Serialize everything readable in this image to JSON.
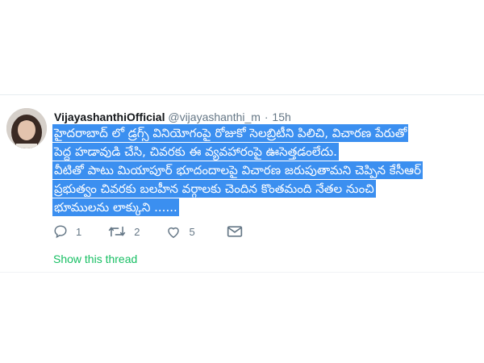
{
  "tweet": {
    "author_name": "VijayashanthiOfficial",
    "handle": "@vijayashanthi_m",
    "separator": "·",
    "time": "15h",
    "text_lines": [
      "హైదరాబాద్ లో డ్రగ్స్ వినియోగంపై రోజుకో సెలబ్రిటీని పిలిచి, విచారణ పేరుతో",
      "పెద్ద హడావుడి చేసి, చివరకు ఈ వ్యవహారంపై ఊసెత్తడంలేదు.",
      "వీటితో పాటు మియాపూర్ భూదందాలపై విచారణ జరుపుతామని చెప్పిన కేసీఆర్",
      "ప్రభుత్వం చివరకు బలహీన వర్గాలకు చెందిన కొంతమంది నేతల నుంచి",
      "భూములను లాక్కుని ......"
    ],
    "highlight_color": "#3b8ff0",
    "actions": {
      "reply": {
        "icon": "reply-icon",
        "count": "1"
      },
      "retweet": {
        "icon": "retweet-icon",
        "count": "2"
      },
      "like": {
        "icon": "heart-icon",
        "count": "5"
      },
      "message": {
        "icon": "envelope-icon"
      }
    },
    "show_thread": "Show this thread",
    "show_thread_color": "#17bf63"
  }
}
